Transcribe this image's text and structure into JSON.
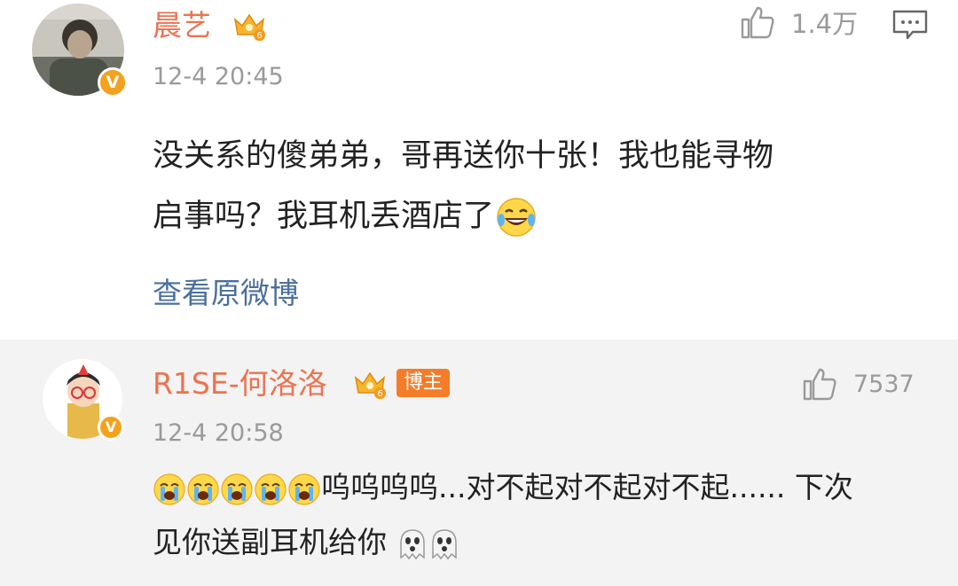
{
  "comments": [
    {
      "username": "晨艺",
      "verified_mark": "V",
      "time": "12-4 20:45",
      "likes": "1.4万",
      "text_line1": "没关系的傻弟弟，哥再送你十张！我也能寻物",
      "text_line2": "启事吗？我耳机丢酒店了",
      "emoji": "laughing-tears-emoji",
      "view_original": "查看原微博",
      "level": "6"
    },
    {
      "username": "R1SE-何洛洛",
      "verified_mark": "V",
      "badge": "博主",
      "time": "12-4 20:58",
      "likes": "7537",
      "text_line1": "呜呜呜呜...对不起对不起对不起...... 下次",
      "text_line2": "见你送副耳机给你",
      "emoji_prefix": "crying-emoji x5",
      "emoji_suffix": "ghost-emoji x2",
      "level": "6"
    }
  ],
  "colors": {
    "username": "#eb7350",
    "link": "#4a6f9e",
    "meta": "#9a9a9a",
    "host_badge": "#f57c28",
    "vip_gold": "#f4a21d"
  }
}
